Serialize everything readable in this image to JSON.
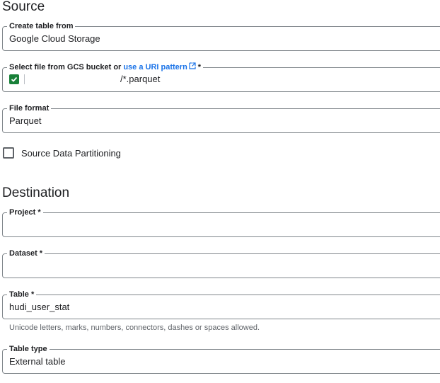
{
  "source": {
    "title": "Source",
    "create_table_from": {
      "label": "Create table from",
      "value": "Google Cloud Storage"
    },
    "select_file": {
      "label": "Select file from GCS bucket or",
      "link_text": "use a URI pattern",
      "link_icon": "open-in-new-icon",
      "required_mark": "*",
      "validated": true,
      "validated_icon": "check-icon",
      "path_suffix": "/*.parquet"
    },
    "file_format": {
      "label": "File format",
      "value": "Parquet"
    },
    "partitioning": {
      "label": "Source Data Partitioning",
      "checked": false
    }
  },
  "destination": {
    "title": "Destination",
    "project": {
      "label": "Project *",
      "value": ""
    },
    "dataset": {
      "label": "Dataset *",
      "value": ""
    },
    "table": {
      "label": "Table *",
      "value": "hudi_user_stat",
      "hint": "Unicode letters, marks, numbers, connectors, dashes or spaces allowed."
    },
    "table_type": {
      "label": "Table type",
      "value": "External table"
    }
  },
  "colors": {
    "link": "#1a73e8",
    "valid_check": "#188038",
    "border": "#80868b",
    "hint_text": "#5f6368"
  }
}
